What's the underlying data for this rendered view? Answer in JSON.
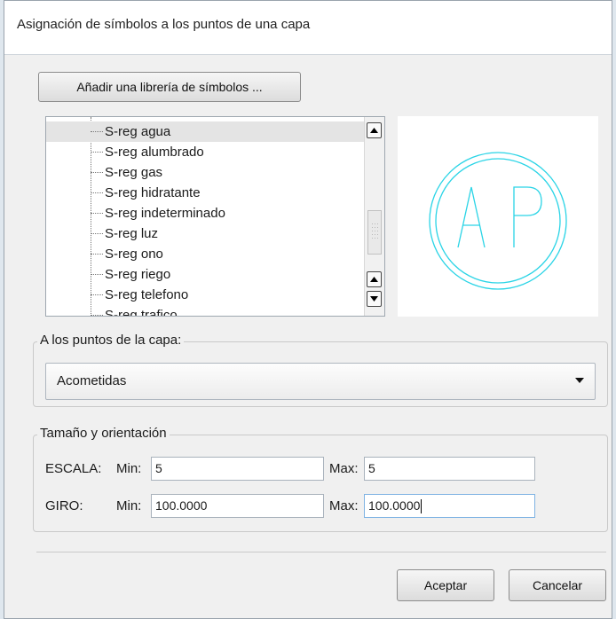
{
  "window": {
    "title": "Asignación de símbolos a los puntos de una capa"
  },
  "library_button": {
    "label": "Añadir una librería de símbolos ..."
  },
  "symbol_list": {
    "items": [
      {
        "label": "S-reg agua",
        "selected": true
      },
      {
        "label": "S-reg alumbrado",
        "selected": false
      },
      {
        "label": "S-reg gas",
        "selected": false
      },
      {
        "label": "S-reg hidratante",
        "selected": false
      },
      {
        "label": "S-reg indeterminado",
        "selected": false
      },
      {
        "label": "S-reg luz",
        "selected": false
      },
      {
        "label": "S-reg ono",
        "selected": false
      },
      {
        "label": "S-reg riego",
        "selected": false
      },
      {
        "label": "S-reg telefono",
        "selected": false
      },
      {
        "label": "S-reg trafico",
        "selected": false
      }
    ]
  },
  "preview": {
    "symbol_text": "AP",
    "stroke_color": "#2ad4e6"
  },
  "layer_group": {
    "legend": "A los puntos de la capa:",
    "selected_layer": "Acometidas"
  },
  "size_group": {
    "legend": "Tamaño y orientación",
    "escala": {
      "label": "ESCALA:",
      "min_label": "Min:",
      "min_value": "5",
      "max_label": "Max:",
      "max_value": "5"
    },
    "giro": {
      "label": "GIRO:",
      "min_label": "Min:",
      "min_value": "100.0000",
      "max_label": "Max:",
      "max_value": "100.0000"
    }
  },
  "buttons": {
    "accept": "Aceptar",
    "cancel": "Cancelar"
  }
}
